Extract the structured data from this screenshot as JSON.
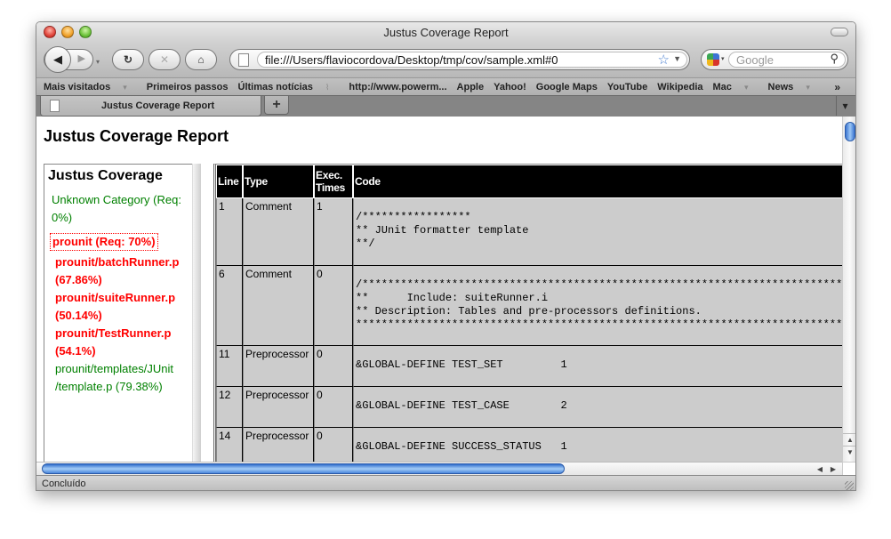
{
  "window": {
    "title": "Justus Coverage Report"
  },
  "toolbar": {
    "back_icon": "◀",
    "forward_icon": "▶",
    "history_dropdown_icon": "▾",
    "reload_icon": "↻",
    "stop_icon": "✕",
    "home_icon": "⌂",
    "url": "file:///Users/flaviocordova/Desktop/tmp/cov/sample.xml#0",
    "bookmark_star_icon": "☆",
    "url_dropdown_icon": "▼",
    "search_engine_dropdown_icon": "▾",
    "search_placeholder": "Google",
    "search_icon": "⚲"
  },
  "bookmarks": [
    {
      "label": "Mais visitados",
      "dropdown": true
    },
    {
      "label": "Primeiros passos"
    },
    {
      "label": "Últimas notícias",
      "rss": true
    },
    {
      "label": "http://www.powerm..."
    },
    {
      "label": "Apple"
    },
    {
      "label": "Yahoo!"
    },
    {
      "label": "Google Maps"
    },
    {
      "label": "YouTube"
    },
    {
      "label": "Wikipedia"
    },
    {
      "label": "Mac",
      "dropdown": true
    },
    {
      "label": "News",
      "dropdown": true
    }
  ],
  "bookmarks_overflow_icon": "»",
  "bookmarks_caret": "▾",
  "bookmarks_rss_icon": "⌇",
  "tabs": [
    {
      "label": "Justus Coverage Report",
      "active": true
    }
  ],
  "new_tab_label": "+",
  "tab_list_icon": "▾",
  "page": {
    "title": "Justus Coverage Report",
    "sidebar": {
      "title": "Justus Coverage",
      "categories": [
        {
          "label": "Unknown Category (Req: 0%)",
          "status": "pass"
        },
        {
          "label": "prounit (Req: 70%)",
          "status": "fail",
          "selected": true
        }
      ],
      "files": [
        {
          "label": "prounit/batchRunner.p (67.86%)",
          "status": "fail"
        },
        {
          "label": "prounit/suiteRunner.p (50.14%)",
          "status": "fail"
        },
        {
          "label": "prounit/TestRunner.p (54.1%)",
          "status": "fail"
        },
        {
          "label": "prounit/templates/JUnit /template.p (79.38%)",
          "status": "pass"
        }
      ]
    },
    "table": {
      "headers": [
        "Line",
        "Type",
        "Exec. Times",
        "Code"
      ],
      "rows": [
        {
          "line": "1",
          "type": "Comment",
          "exec": "1",
          "code": "/*****************\n** JUnit formatter template\n**/"
        },
        {
          "line": "6",
          "type": "Comment",
          "exec": "0",
          "code": "/*****************************************************************************\n**      Include: suiteRunner.i\n** Description: Tables and pre-processors definitions.\n*****************************************************************************"
        },
        {
          "line": "11",
          "type": "Preprocessor",
          "exec": "0",
          "code": "&GLOBAL-DEFINE TEST_SET         1"
        },
        {
          "line": "12",
          "type": "Preprocessor",
          "exec": "0",
          "code": "&GLOBAL-DEFINE TEST_CASE        2"
        },
        {
          "line": "14",
          "type": "Preprocessor",
          "exec": "0",
          "code": "&GLOBAL-DEFINE SUCCESS_STATUS   1"
        }
      ]
    }
  },
  "scrollbars": {
    "up_icon": "▲",
    "down_icon": "▼",
    "left_icon": "◀",
    "right_icon": "▶"
  },
  "status": {
    "text": "Concluído"
  },
  "colors": {
    "pass": "#008000",
    "fail": "#ff0000",
    "header_bg": "#000000",
    "cell_bg": "#cccccc"
  }
}
